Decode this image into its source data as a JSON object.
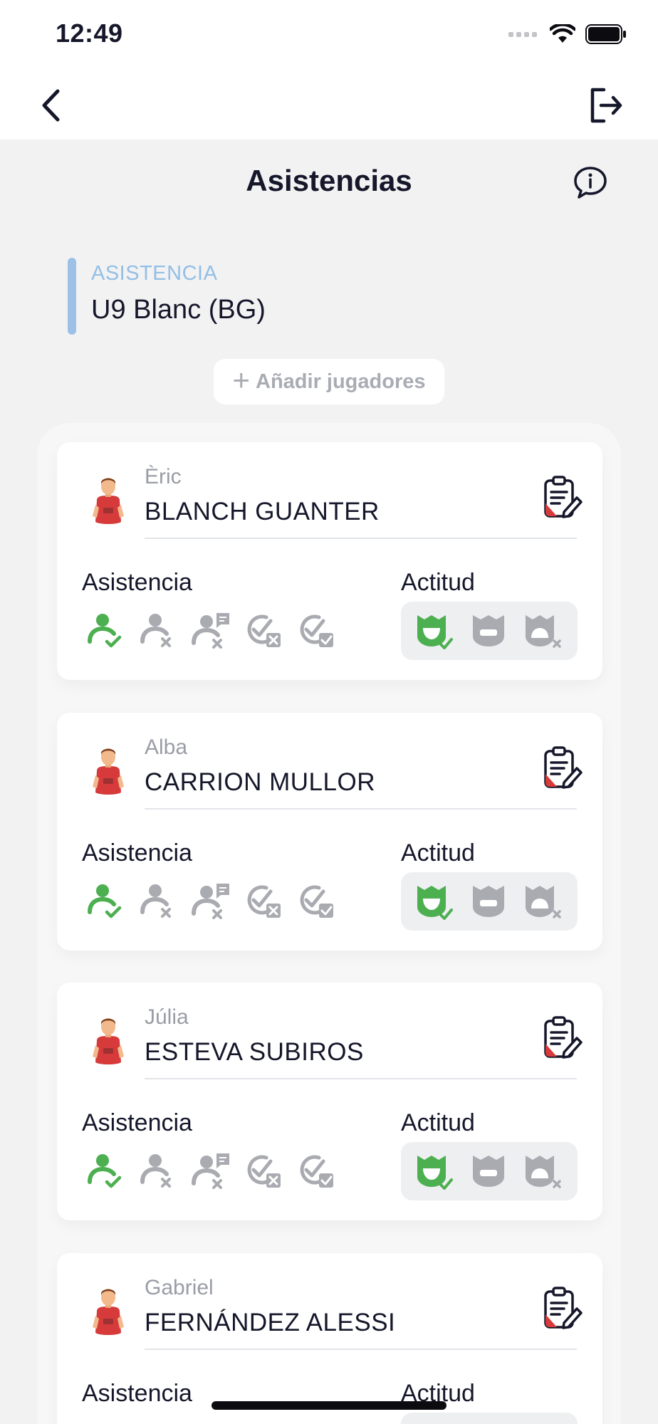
{
  "status_bar": {
    "time": "12:49"
  },
  "header": {
    "title": "Asistencias"
  },
  "section": {
    "label": "ASISTENCIA",
    "team": "U9 Blanc (BG)"
  },
  "add_players": {
    "label": "Añadir jugadores"
  },
  "labels": {
    "attendance": "Asistencia",
    "attitude": "Actitud"
  },
  "players": [
    {
      "first_name": "Èric",
      "last_name": "BLANCH GUANTER"
    },
    {
      "first_name": "Alba",
      "last_name": "CARRION MULLOR"
    },
    {
      "first_name": "Júlia",
      "last_name": "ESTEVA SUBIROS"
    },
    {
      "first_name": "Gabriel",
      "last_name": "FERNÁNDEZ ALESSI"
    }
  ],
  "colors": {
    "active_green": "#4caf50",
    "inactive_gray": "#a9abb1",
    "accent_blue": "#9cc0e6",
    "jersey_red": "#d63a3a"
  },
  "icons": {
    "attendance": [
      "present-icon",
      "absent-icon",
      "justified-absence-icon",
      "injured-icon",
      "late-icon"
    ],
    "attitude": [
      "good-attitude-icon",
      "neutral-attitude-icon",
      "bad-attitude-icon"
    ]
  }
}
